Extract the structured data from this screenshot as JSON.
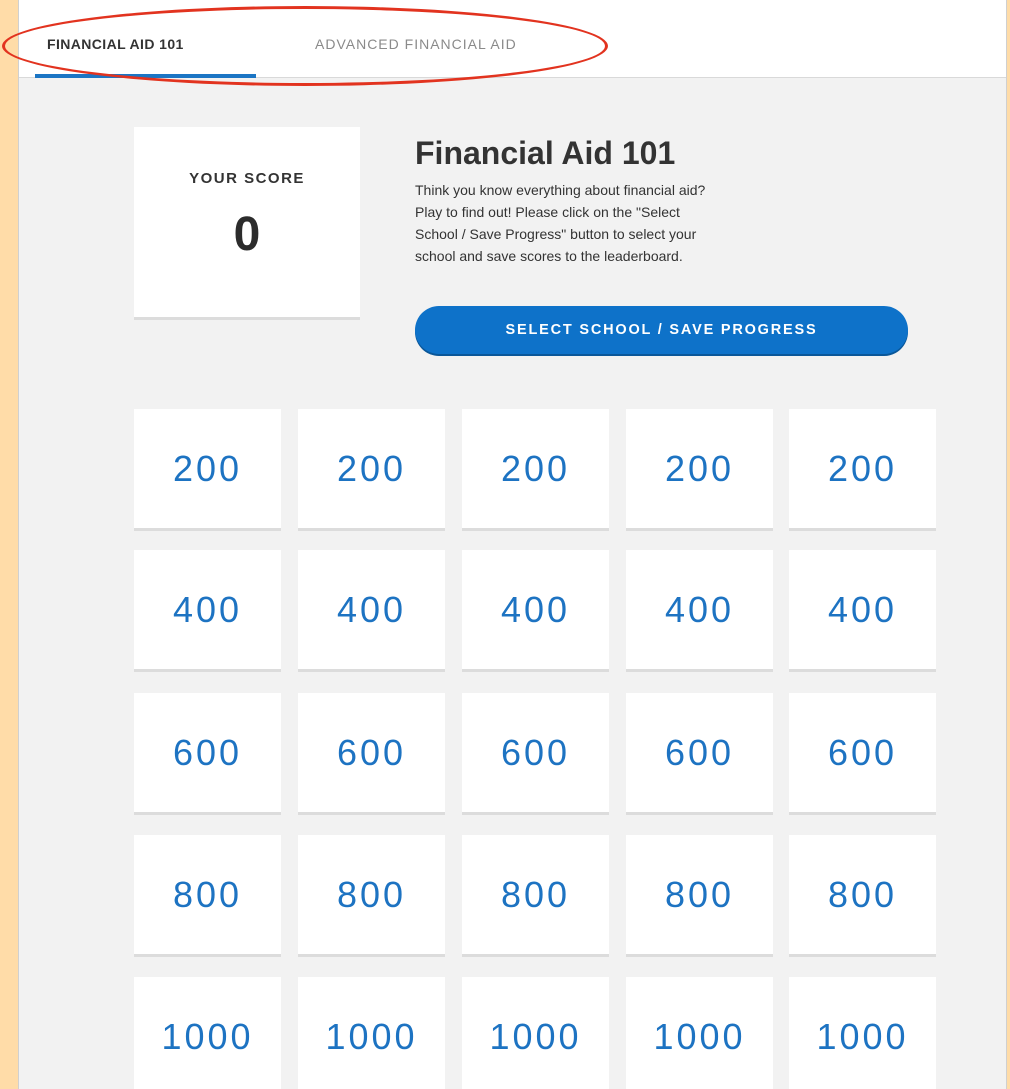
{
  "tabs": [
    {
      "label": "FINANCIAL AID 101",
      "active": true
    },
    {
      "label": "ADVANCED FINANCIAL AID",
      "active": false
    }
  ],
  "score": {
    "label": "YOUR SCORE",
    "value": "0"
  },
  "info": {
    "title": "Financial Aid 101",
    "lines": [
      "Think you know everything about financial aid?",
      "Play to find out! Please click on the \"Select",
      "School / Save Progress\" button to select your",
      "school and save scores to the leaderboard."
    ]
  },
  "select_button": {
    "label": "SELECT SCHOOL / SAVE PROGRESS"
  },
  "board": {
    "rows": [
      [
        "200",
        "200",
        "200",
        "200",
        "200"
      ],
      [
        "400",
        "400",
        "400",
        "400",
        "400"
      ],
      [
        "600",
        "600",
        "600",
        "600",
        "600"
      ],
      [
        "800",
        "800",
        "800",
        "800",
        "800"
      ],
      [
        "1000",
        "1000",
        "1000",
        "1000",
        "1000"
      ]
    ]
  },
  "colors": {
    "accent": "#1b75c4",
    "button": "#0e72c9",
    "tile_text": "#1d73c2",
    "annotation": "#e2331f",
    "outer_background": "#ffdca8"
  }
}
